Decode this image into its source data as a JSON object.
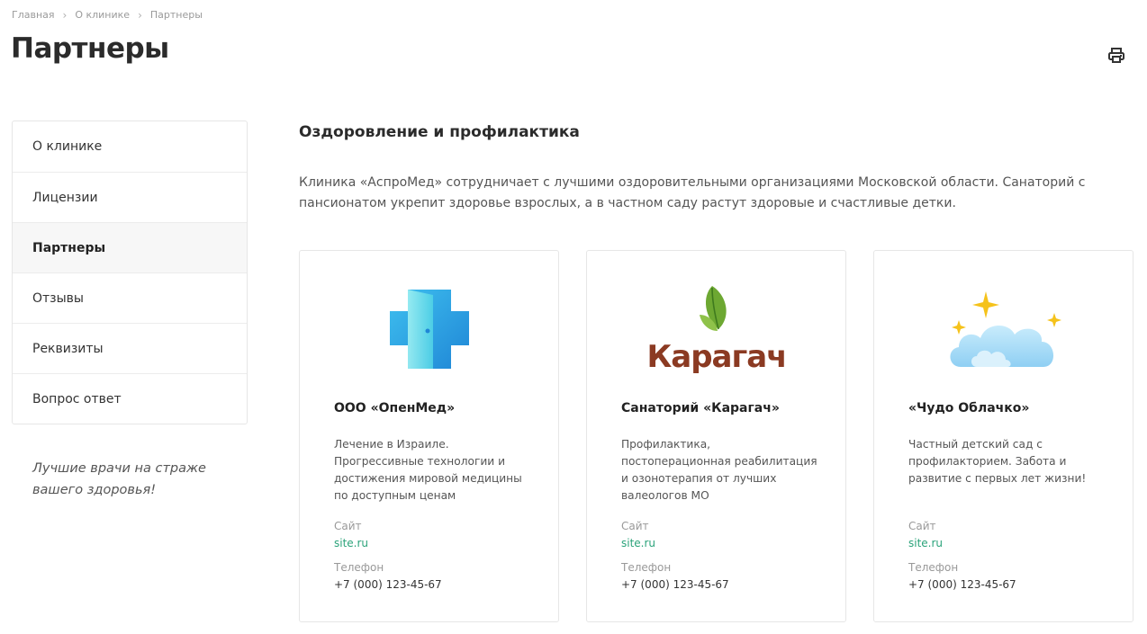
{
  "breadcrumb": [
    "Главная",
    "О клинике",
    "Партнеры"
  ],
  "page_title": "Партнеры",
  "sidebar": {
    "items": [
      {
        "label": "О клинике",
        "active": false
      },
      {
        "label": "Лицензии",
        "active": false
      },
      {
        "label": "Партнеры",
        "active": true
      },
      {
        "label": "Отзывы",
        "active": false
      },
      {
        "label": "Реквизиты",
        "active": false
      },
      {
        "label": "Вопрос ответ",
        "active": false
      }
    ],
    "slogan": "Лучшие врачи на страже вашего здоровья!"
  },
  "section": {
    "title": "Оздоровление и профилактика",
    "intro": "Клиника «АспроМед» сотрудничает с лучшими оздоровительными организациями Московской области. Санаторий с пансионатом укрепит здоровье взрослых, а в частном саду растут здоровые и счастливые детки."
  },
  "cards": [
    {
      "name": "ООО «ОпенМед»",
      "description": "Лечение в Израиле. Прогрессивные технологии и достижения мировой медицины по доступным ценам",
      "site_label": "Сайт",
      "site": "site.ru",
      "phone_label": "Телефон",
      "phone": "+7 (000) 123-45-67",
      "logo_icon": "medical-cross-door-icon"
    },
    {
      "name": "Санаторий «Карагач»",
      "description": "Профилактика, постоперационная реабилитация и озонотерапия от лучших валеологов МО",
      "site_label": "Сайт",
      "site": "site.ru",
      "phone_label": "Телефон",
      "phone": "+7 (000) 123-45-67",
      "logo_icon": "leaf-icon",
      "logo_text": "Карагач"
    },
    {
      "name": "«Чудо Облачко»",
      "description": "Частный детский сад с профилакторием. Забота и развитие с первых лет жизни!",
      "site_label": "Сайт",
      "site": "site.ru",
      "phone_label": "Телефон",
      "phone": "+7 (000) 123-45-67",
      "logo_icon": "cloud-stars-icon"
    }
  ],
  "colors": {
    "accent_link": "#2ba37a",
    "brand_brown": "#8b3a22",
    "leaf_green": "#6da832",
    "cross_blue": "#2aa3e0",
    "cloud_blue": "#9fd6f6",
    "star_gold": "#f5c21b"
  }
}
